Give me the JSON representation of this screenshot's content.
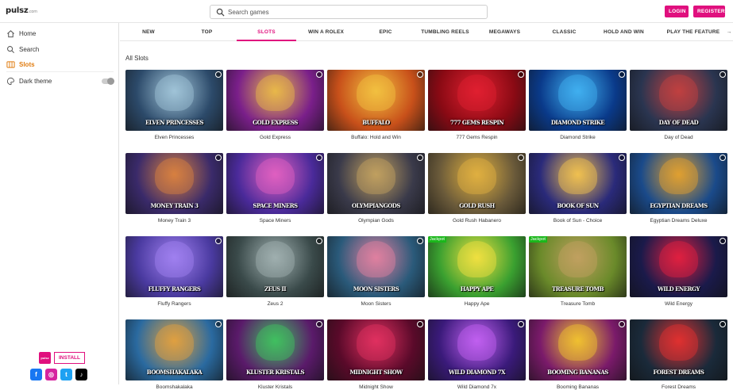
{
  "header": {
    "logo_text": "pulsz",
    "logo_suffix": ".com",
    "search_placeholder": "Search games",
    "login_label": "LOGIN",
    "register_label": "REGISTER"
  },
  "sidebar": {
    "items": [
      {
        "label": "Home",
        "icon": "home-icon"
      },
      {
        "label": "Search",
        "icon": "search-icon"
      },
      {
        "label": "Slots",
        "icon": "slots-icon",
        "active": true
      }
    ],
    "dark_theme_label": "Dark theme",
    "dark_theme_on": false,
    "badge_text": "pulsz",
    "install_label": "INSTALL",
    "socials": [
      {
        "icon": "facebook-icon",
        "glyph": "f",
        "color": "#1877f2"
      },
      {
        "icon": "instagram-icon",
        "glyph": "◎",
        "color": "#d6249f"
      },
      {
        "icon": "twitter-icon",
        "glyph": "t",
        "color": "#1da1f2"
      },
      {
        "icon": "tiktok-icon",
        "glyph": "♪",
        "color": "#000000"
      }
    ]
  },
  "categories": [
    "NEW",
    "TOP",
    "SLOTS",
    "WIN A ROLEX",
    "EPIC",
    "TUMBLING REELS",
    "MEGAWAYS",
    "CLASSIC",
    "HOLD AND WIN",
    "PLAY THE FEATURE"
  ],
  "active_category": "SLOTS",
  "section_title": "All Slots",
  "colors": {
    "brand": "#e0107e",
    "active_sidebar": "#e07c10"
  },
  "games": [
    {
      "name": "Elven Princesses",
      "art_title": "ELVEN PRINCESSES",
      "bg": "#2c4a6a",
      "accent": "#a0c4d8"
    },
    {
      "name": "Gold Express",
      "art_title": "GOLD EXPRESS",
      "bg": "#7a1f8a",
      "accent": "#e8b84a"
    },
    {
      "name": "Buffalo: Hold and Win",
      "art_title": "BUFFALO",
      "bg": "#c8501a",
      "accent": "#f2c040"
    },
    {
      "name": "777 Gems Respin",
      "art_title": "777 GEMS RESPIN",
      "bg": "#8a0a14",
      "accent": "#e02030"
    },
    {
      "name": "Diamond Strike",
      "art_title": "DIAMOND STRIKE",
      "bg": "#0a3a8a",
      "accent": "#40b0f0"
    },
    {
      "name": "Day of Dead",
      "art_title": "DAY OF DEAD",
      "bg": "#2a3550",
      "accent": "#c04040"
    },
    {
      "name": "Money Train 3",
      "art_title": "MONEY TRAIN 3",
      "bg": "#3a2a6a",
      "accent": "#d88040"
    },
    {
      "name": "Space Miners",
      "art_title": "SPACE MINERS",
      "bg": "#4a2a9a",
      "accent": "#e060c0"
    },
    {
      "name": "Olympian Gods",
      "art_title": "OLYMPIANGODS",
      "bg": "#3a3a4a",
      "accent": "#c0a060"
    },
    {
      "name": "Gold Rush Habanero",
      "art_title": "GOLD RUSH",
      "bg": "#6a5a3a",
      "accent": "#e0b040"
    },
    {
      "name": "Book of Sun - Choice",
      "art_title": "BOOK OF SUN",
      "bg": "#2a2a7a",
      "accent": "#f0c050"
    },
    {
      "name": "Egyptian Dreams Deluxe",
      "art_title": "EGYPTIAN DREAMS",
      "bg": "#1a4a8a",
      "accent": "#e0a030"
    },
    {
      "name": "Fluffy Rangers",
      "art_title": "FLUFFY RANGERS",
      "bg": "#4a3aa0",
      "accent": "#a080f0"
    },
    {
      "name": "Zeus 2",
      "art_title": "ZEUS II",
      "bg": "#3a4a4a",
      "accent": "#a0b0b0"
    },
    {
      "name": "Moon Sisters",
      "art_title": "MOON SISTERS",
      "bg": "#2a5a7a",
      "accent": "#e080a0"
    },
    {
      "name": "Happy Ape",
      "art_title": "HAPPY APE",
      "bg": "#3aa030",
      "accent": "#f0e040",
      "jackpot": "Jackpot"
    },
    {
      "name": "Treasure Tomb",
      "art_title": "TREASURE TOMB",
      "bg": "#6a8a2a",
      "accent": "#c0a060",
      "jackpot": "Jackpot"
    },
    {
      "name": "Wild Energy",
      "art_title": "WILD ENERGY",
      "bg": "#1a1a4a",
      "accent": "#e02040"
    },
    {
      "name": "Boomshakalaka",
      "art_title": "BOOMSHAKALAKA",
      "bg": "#2a6aa0",
      "accent": "#e0a040"
    },
    {
      "name": "Kluster Kristals",
      "art_title": "KLUSTER KRISTALS",
      "bg": "#5a1a6a",
      "accent": "#40c060"
    },
    {
      "name": "Midnight Show",
      "art_title": "MIDNIGHT SHOW",
      "bg": "#5a0a2a",
      "accent": "#e03060"
    },
    {
      "name": "Wild Diamond 7x",
      "art_title": "WILD DIAMOND 7X",
      "bg": "#3a1a7a",
      "accent": "#c060f0"
    },
    {
      "name": "Booming Bananas",
      "art_title": "BOOMING BANANAS",
      "bg": "#7a1a6a",
      "accent": "#f0c030"
    },
    {
      "name": "Forest Dreams",
      "art_title": "FOREST DREAMS",
      "bg": "#1a2a3a",
      "accent": "#e03030"
    }
  ]
}
